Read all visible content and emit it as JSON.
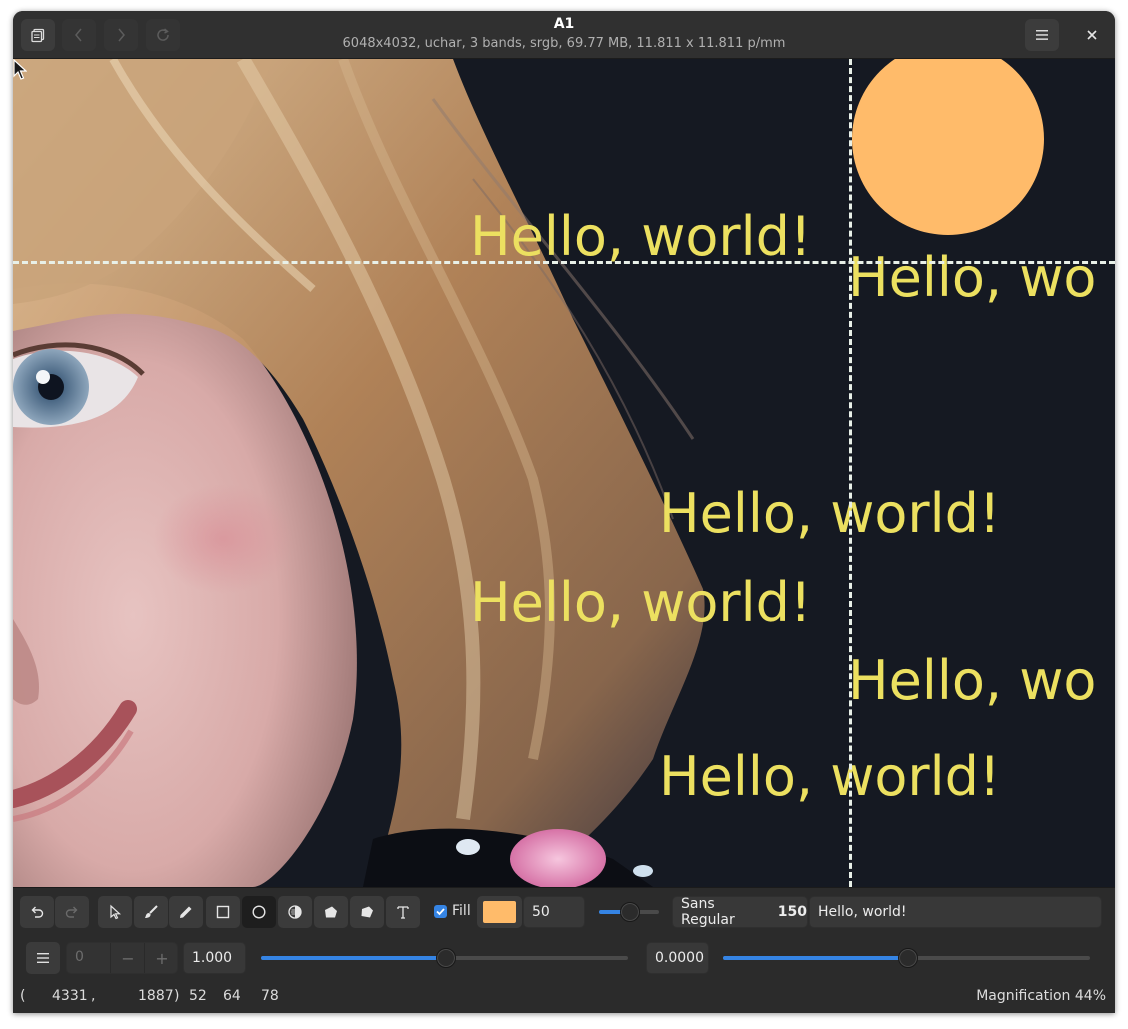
{
  "header": {
    "title": "A1",
    "subtitle": "6048x4032,  uchar, 3 bands, srgb, 69.77 MB, 11.811 x 11.811 p/mm",
    "icons": {
      "gallery": "image-gallery-icon",
      "back": "chevron-left-icon",
      "forward": "chevron-right-icon",
      "reload": "reload-icon",
      "menu": "hamburger-menu-icon",
      "close": "close-icon"
    }
  },
  "canvas": {
    "text_annotations": [
      "Hello, world!",
      "Hello, wo",
      "Hello, world!",
      "Hello, world!",
      "Hello, wo",
      "Hello, world!"
    ],
    "text_color": "#ece060",
    "circle_color": "#ffbb6a",
    "background_color": "#151922"
  },
  "draw_toolbar": {
    "tools": [
      "undo-icon",
      "redo-icon",
      "pointer-icon",
      "brush-icon",
      "pencil-icon",
      "rectangle-icon",
      "circle-icon",
      "flood-fill-icon",
      "polygon-icon",
      "path-icon",
      "text-icon"
    ],
    "fill_checked": true,
    "fill_label": "Fill",
    "fill_color": "#ffbb6a",
    "line_width": "50",
    "line_width_level": 0.5,
    "font_name": "Sans Regular",
    "font_size": "150",
    "text_value": "Hello, world!"
  },
  "view_toolbar": {
    "menu_icon": "hamburger-menu-icon",
    "page_value": "0",
    "scale_value": "1.000",
    "scale_level": 0.5,
    "offset_value": "0.0000",
    "offset_level": 0.5
  },
  "status": {
    "coord_open": "(",
    "coord_x": "4331",
    "coord_sep": ",",
    "coord_y": "1887",
    "coord_close": ")",
    "band_r": "52",
    "band_g": "64",
    "band_b": "78",
    "magnification": "Magnification 44%"
  },
  "accent_color": "#3584e4"
}
